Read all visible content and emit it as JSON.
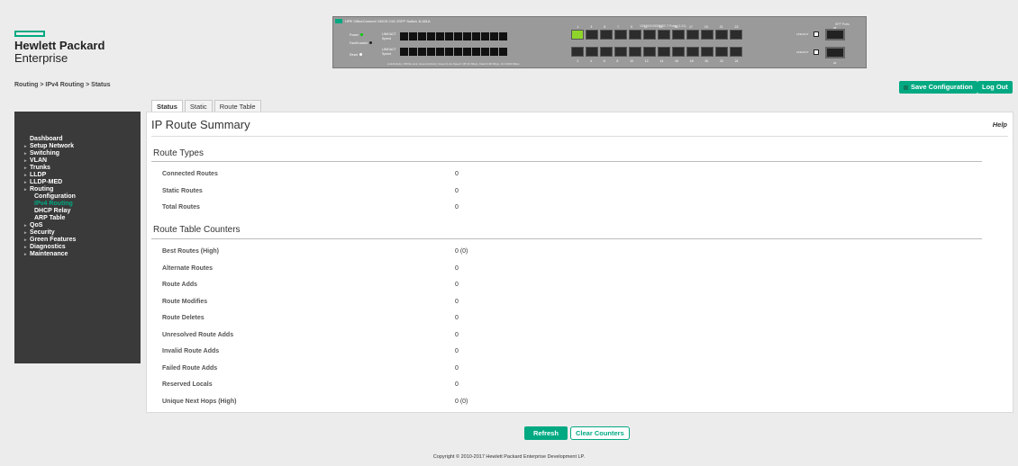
{
  "brand": {
    "line1": "Hewlett Packard",
    "line2": "Enterprise"
  },
  "breadcrumb": "Routing > IPv4 Routing > Status",
  "switch": {
    "tag": "",
    "model": "HPE OfficeConnect 1920S 24G 2SFP Switch JL381A",
    "ports_title": "10/100/1000BASE-T Ports (1-24)",
    "sfp_title": "SFP Ports",
    "leds": [
      "Power",
      "Fault/Locator",
      "Reset"
    ],
    "led_labels": [
      "LINK/ACT",
      "Speed"
    ],
    "top_nums": [
      "1",
      "3",
      "5",
      "7",
      "9",
      "11",
      "13",
      "15",
      "17",
      "19",
      "21",
      "23"
    ],
    "bottom_nums": [
      "2",
      "4",
      "6",
      "8",
      "10",
      "12",
      "14",
      "16",
      "18",
      "20",
      "22",
      "24"
    ],
    "sfp_nums": [
      "25",
      "26"
    ],
    "footer": "Link/Activity: Off=No Link, Green=Activity; Green=Link    Speed: Off=10 Mbps, Flash=100 Mbps, On=1000 Mbps"
  },
  "toolbar": {
    "save_label": "Save Configuration",
    "logout_label": "Log Out"
  },
  "tabs": [
    "Status",
    "Static",
    "Route Table"
  ],
  "sidebar": {
    "items": [
      {
        "label": "Dashboard",
        "arrow": false
      },
      {
        "label": "Setup Network",
        "arrow": true
      },
      {
        "label": "Switching",
        "arrow": true
      },
      {
        "label": "VLAN",
        "arrow": true
      },
      {
        "label": "Trunks",
        "arrow": true
      },
      {
        "label": "LLDP",
        "arrow": true
      },
      {
        "label": "LLDP-MED",
        "arrow": true
      },
      {
        "label": "Routing",
        "arrow": true
      }
    ],
    "sub_items": [
      "Configuration",
      "IPv4 Routing",
      "DHCP Relay",
      "ARP Table"
    ],
    "items_after": [
      {
        "label": "QoS"
      },
      {
        "label": "Security"
      },
      {
        "label": "Green Features"
      },
      {
        "label": "Diagnostics"
      },
      {
        "label": "Maintenance"
      }
    ]
  },
  "main": {
    "title": "IP Route Summary",
    "help": "Help",
    "route_types": {
      "heading": "Route Types",
      "rows": [
        {
          "label": "Connected Routes",
          "value": "0"
        },
        {
          "label": "Static Routes",
          "value": "0"
        },
        {
          "label": "Total Routes",
          "value": "0"
        }
      ]
    },
    "counters": {
      "heading": "Route Table Counters",
      "rows": [
        {
          "label": "Best Routes (High)",
          "value": "0 (0)"
        },
        {
          "label": "Alternate Routes",
          "value": "0"
        },
        {
          "label": "Route Adds",
          "value": "0"
        },
        {
          "label": "Route Modifies",
          "value": "0"
        },
        {
          "label": "Route Deletes",
          "value": "0"
        },
        {
          "label": "Unresolved Route Adds",
          "value": "0"
        },
        {
          "label": "Invalid Route Adds",
          "value": "0"
        },
        {
          "label": "Failed Route Adds",
          "value": "0"
        },
        {
          "label": "Reserved Locals",
          "value": "0"
        },
        {
          "label": "Unique Next Hops (High)",
          "value": "0 (0)"
        }
      ]
    }
  },
  "buttons": {
    "refresh": "Refresh",
    "clear": "Clear Counters"
  },
  "copyright": "Copyright © 2010-2017 Hewlett Packard Enterprise Development LP."
}
